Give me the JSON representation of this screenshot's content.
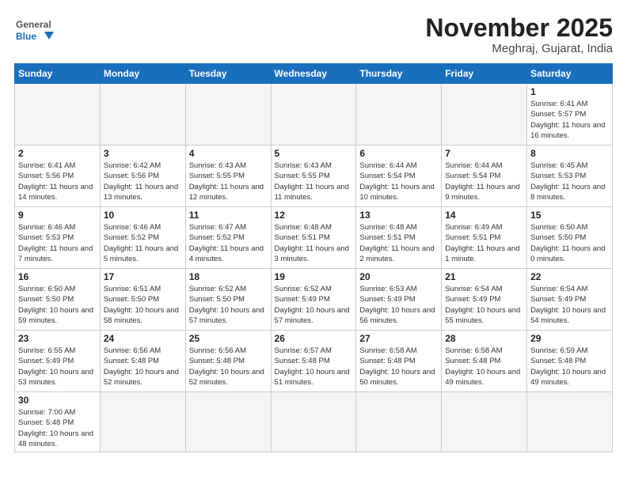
{
  "logo": {
    "text_general": "General",
    "text_blue": "Blue"
  },
  "header": {
    "month_title": "November 2025",
    "location": "Meghraj, Gujarat, India"
  },
  "weekdays": [
    "Sunday",
    "Monday",
    "Tuesday",
    "Wednesday",
    "Thursday",
    "Friday",
    "Saturday"
  ],
  "weeks": [
    [
      {
        "day": "",
        "info": ""
      },
      {
        "day": "",
        "info": ""
      },
      {
        "day": "",
        "info": ""
      },
      {
        "day": "",
        "info": ""
      },
      {
        "day": "",
        "info": ""
      },
      {
        "day": "",
        "info": ""
      },
      {
        "day": "1",
        "info": "Sunrise: 6:41 AM\nSunset: 5:57 PM\nDaylight: 11 hours\nand 16 minutes."
      }
    ],
    [
      {
        "day": "2",
        "info": "Sunrise: 6:41 AM\nSunset: 5:56 PM\nDaylight: 11 hours\nand 14 minutes."
      },
      {
        "day": "3",
        "info": "Sunrise: 6:42 AM\nSunset: 5:56 PM\nDaylight: 11 hours\nand 13 minutes."
      },
      {
        "day": "4",
        "info": "Sunrise: 6:43 AM\nSunset: 5:55 PM\nDaylight: 11 hours\nand 12 minutes."
      },
      {
        "day": "5",
        "info": "Sunrise: 6:43 AM\nSunset: 5:55 PM\nDaylight: 11 hours\nand 11 minutes."
      },
      {
        "day": "6",
        "info": "Sunrise: 6:44 AM\nSunset: 5:54 PM\nDaylight: 11 hours\nand 10 minutes."
      },
      {
        "day": "7",
        "info": "Sunrise: 6:44 AM\nSunset: 5:54 PM\nDaylight: 11 hours\nand 9 minutes."
      },
      {
        "day": "8",
        "info": "Sunrise: 6:45 AM\nSunset: 5:53 PM\nDaylight: 11 hours\nand 8 minutes."
      }
    ],
    [
      {
        "day": "9",
        "info": "Sunrise: 6:46 AM\nSunset: 5:53 PM\nDaylight: 11 hours\nand 7 minutes."
      },
      {
        "day": "10",
        "info": "Sunrise: 6:46 AM\nSunset: 5:52 PM\nDaylight: 11 hours\nand 5 minutes."
      },
      {
        "day": "11",
        "info": "Sunrise: 6:47 AM\nSunset: 5:52 PM\nDaylight: 11 hours\nand 4 minutes."
      },
      {
        "day": "12",
        "info": "Sunrise: 6:48 AM\nSunset: 5:51 PM\nDaylight: 11 hours\nand 3 minutes."
      },
      {
        "day": "13",
        "info": "Sunrise: 6:48 AM\nSunset: 5:51 PM\nDaylight: 11 hours\nand 2 minutes."
      },
      {
        "day": "14",
        "info": "Sunrise: 6:49 AM\nSunset: 5:51 PM\nDaylight: 11 hours\nand 1 minute."
      },
      {
        "day": "15",
        "info": "Sunrise: 6:50 AM\nSunset: 5:50 PM\nDaylight: 11 hours\nand 0 minutes."
      }
    ],
    [
      {
        "day": "16",
        "info": "Sunrise: 6:50 AM\nSunset: 5:50 PM\nDaylight: 10 hours\nand 59 minutes."
      },
      {
        "day": "17",
        "info": "Sunrise: 6:51 AM\nSunset: 5:50 PM\nDaylight: 10 hours\nand 58 minutes."
      },
      {
        "day": "18",
        "info": "Sunrise: 6:52 AM\nSunset: 5:50 PM\nDaylight: 10 hours\nand 57 minutes."
      },
      {
        "day": "19",
        "info": "Sunrise: 6:52 AM\nSunset: 5:49 PM\nDaylight: 10 hours\nand 57 minutes."
      },
      {
        "day": "20",
        "info": "Sunrise: 6:53 AM\nSunset: 5:49 PM\nDaylight: 10 hours\nand 56 minutes."
      },
      {
        "day": "21",
        "info": "Sunrise: 6:54 AM\nSunset: 5:49 PM\nDaylight: 10 hours\nand 55 minutes."
      },
      {
        "day": "22",
        "info": "Sunrise: 6:54 AM\nSunset: 5:49 PM\nDaylight: 10 hours\nand 54 minutes."
      }
    ],
    [
      {
        "day": "23",
        "info": "Sunrise: 6:55 AM\nSunset: 5:49 PM\nDaylight: 10 hours\nand 53 minutes."
      },
      {
        "day": "24",
        "info": "Sunrise: 6:56 AM\nSunset: 5:48 PM\nDaylight: 10 hours\nand 52 minutes."
      },
      {
        "day": "25",
        "info": "Sunrise: 6:56 AM\nSunset: 5:48 PM\nDaylight: 10 hours\nand 52 minutes."
      },
      {
        "day": "26",
        "info": "Sunrise: 6:57 AM\nSunset: 5:48 PM\nDaylight: 10 hours\nand 51 minutes."
      },
      {
        "day": "27",
        "info": "Sunrise: 6:58 AM\nSunset: 5:48 PM\nDaylight: 10 hours\nand 50 minutes."
      },
      {
        "day": "28",
        "info": "Sunrise: 6:58 AM\nSunset: 5:48 PM\nDaylight: 10 hours\nand 49 minutes."
      },
      {
        "day": "29",
        "info": "Sunrise: 6:59 AM\nSunset: 5:48 PM\nDaylight: 10 hours\nand 49 minutes."
      }
    ],
    [
      {
        "day": "30",
        "info": "Sunrise: 7:00 AM\nSunset: 5:48 PM\nDaylight: 10 hours\nand 48 minutes."
      },
      {
        "day": "",
        "info": ""
      },
      {
        "day": "",
        "info": ""
      },
      {
        "day": "",
        "info": ""
      },
      {
        "day": "",
        "info": ""
      },
      {
        "day": "",
        "info": ""
      },
      {
        "day": "",
        "info": ""
      }
    ]
  ]
}
